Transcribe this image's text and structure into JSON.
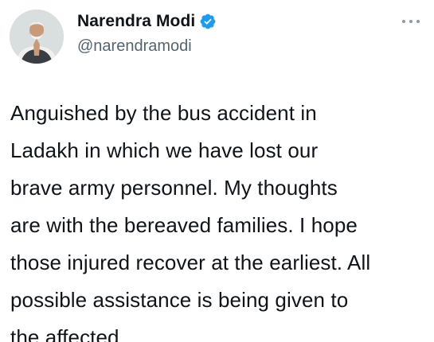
{
  "tweet": {
    "author": {
      "display_name": "Narendra Modi",
      "handle": "@narendramodi",
      "verified": true,
      "avatar_icon": "profile-photo"
    },
    "more_icon": "more-options-icon",
    "text_lines": [
      "Anguished by the bus accident in",
      "Ladakh in which we have lost our",
      "brave army personnel. My thoughts",
      "are with the bereaved families. I hope",
      "those injured recover at the earliest. All",
      "possible assistance is being given to",
      "the affected."
    ]
  },
  "colors": {
    "text": "#0f1419",
    "secondary": "#536471",
    "verified_badge": "#1d9bf0"
  }
}
